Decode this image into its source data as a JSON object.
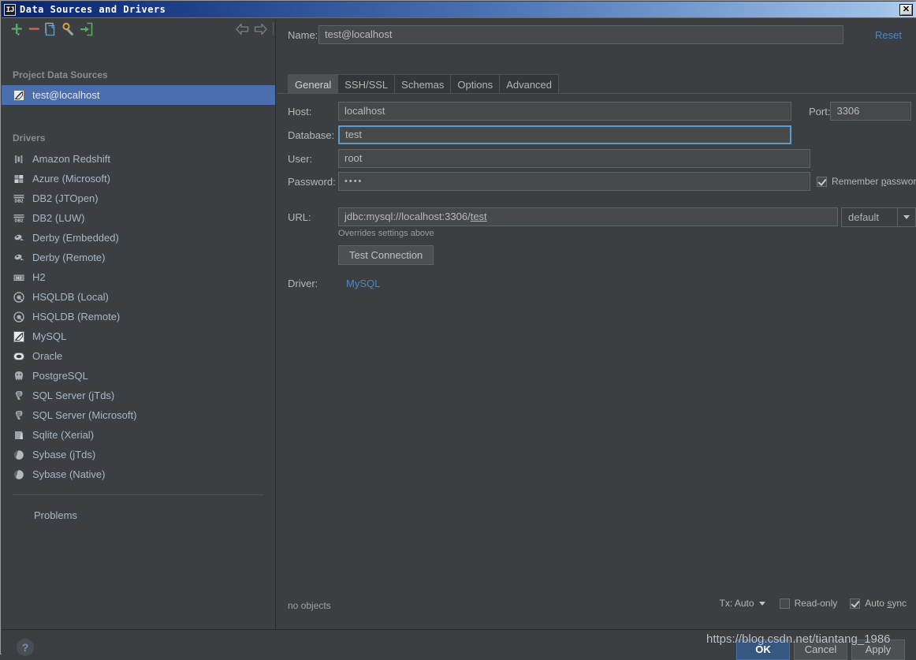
{
  "window": {
    "title": "Data Sources and Drivers",
    "title_icon": "IJ",
    "close_label": "✕"
  },
  "left_panel": {
    "toolbar": [
      {
        "name": "add-data-source-button",
        "icon": "plus-icon",
        "color": "#59a869"
      },
      {
        "name": "remove-data-source-button",
        "icon": "minus-icon",
        "color": "#d9674f"
      },
      {
        "name": "copy-data-source-button",
        "icon": "copy-icon",
        "color": "#6e9ec4"
      },
      {
        "name": "properties-button",
        "icon": "wrench-icon",
        "color": "#d9a343"
      },
      {
        "name": "import-button",
        "icon": "import-arrow-icon",
        "color": "#59a869"
      }
    ],
    "nav_back": "back-arrow-icon",
    "nav_forward": "forward-arrow-icon",
    "project_header": "Project Data Sources",
    "data_sources": [
      {
        "label": "test@localhost",
        "icon": "mysql-icon",
        "selected": true
      }
    ],
    "drivers_header": "Drivers",
    "drivers": [
      {
        "label": "Amazon Redshift",
        "icon": "redshift-icon"
      },
      {
        "label": "Azure (Microsoft)",
        "icon": "azure-icon"
      },
      {
        "label": "DB2 (JTOpen)",
        "icon": "db2-icon"
      },
      {
        "label": "DB2 (LUW)",
        "icon": "db2-icon"
      },
      {
        "label": "Derby (Embedded)",
        "icon": "derby-icon"
      },
      {
        "label": "Derby (Remote)",
        "icon": "derby-icon"
      },
      {
        "label": "H2",
        "icon": "h2-icon"
      },
      {
        "label": "HSQLDB (Local)",
        "icon": "hsqldb-icon"
      },
      {
        "label": "HSQLDB (Remote)",
        "icon": "hsqldb-icon"
      },
      {
        "label": "MySQL",
        "icon": "mysql-icon"
      },
      {
        "label": "Oracle",
        "icon": "oracle-icon"
      },
      {
        "label": "PostgreSQL",
        "icon": "postgres-icon"
      },
      {
        "label": "SQL Server (jTds)",
        "icon": "sqlserver-icon"
      },
      {
        "label": "SQL Server (Microsoft)",
        "icon": "sqlserver-icon"
      },
      {
        "label": "Sqlite (Xerial)",
        "icon": "sqlite-icon"
      },
      {
        "label": "Sybase (jTds)",
        "icon": "sybase-icon"
      },
      {
        "label": "Sybase (Native)",
        "icon": "sybase-icon"
      }
    ],
    "problems_label": "Problems"
  },
  "right_panel": {
    "name_label": "Name:",
    "name_value": "test@localhost",
    "reset_label": "Reset",
    "tabs": [
      {
        "label": "General",
        "active": true
      },
      {
        "label": "SSH/SSL",
        "active": false
      },
      {
        "label": "Schemas",
        "active": false
      },
      {
        "label": "Options",
        "active": false
      },
      {
        "label": "Advanced",
        "active": false
      }
    ],
    "host_label": "Host:",
    "host_value": "localhost",
    "port_label": "Port:",
    "port_value": "3306",
    "database_label": "Database:",
    "database_value": "test",
    "user_label": "User:",
    "user_value": "root",
    "password_label": "Password:",
    "password_value": "••••",
    "remember_password_label": "Remember ",
    "remember_password_mnemonic": "p",
    "remember_password_rest": "assword",
    "remember_password_checked": true,
    "url_label": "URL:",
    "url_prefix": "jdbc:mysql://localhost:3306/",
    "url_db": "test",
    "overrides_note": "Overrides settings above",
    "url_mode": "default",
    "test_connection_label": "Test Connection",
    "driver_label": "Driver:",
    "driver_value": "MySQL",
    "no_objects_label": "no objects",
    "tx_label": "Tx: Auto",
    "readonly_label": "Read-only",
    "readonly_checked": false,
    "autosync_prefix": "Auto ",
    "autosync_mnemonic": "s",
    "autosync_rest": "ync",
    "autosync_checked": true
  },
  "footer": {
    "help_label": "?",
    "ok_label": "OK",
    "cancel_label": "Cancel",
    "apply_label": "Apply"
  },
  "watermark": "https://blog.csdn.net/tiantang_1986",
  "colors": {
    "background": "#3c3f41",
    "selection": "#4b6eaf",
    "accent_link": "#4e86c4",
    "field_background": "#45494a",
    "focus_border": "#5c9ccc",
    "default_button": "#365880"
  }
}
